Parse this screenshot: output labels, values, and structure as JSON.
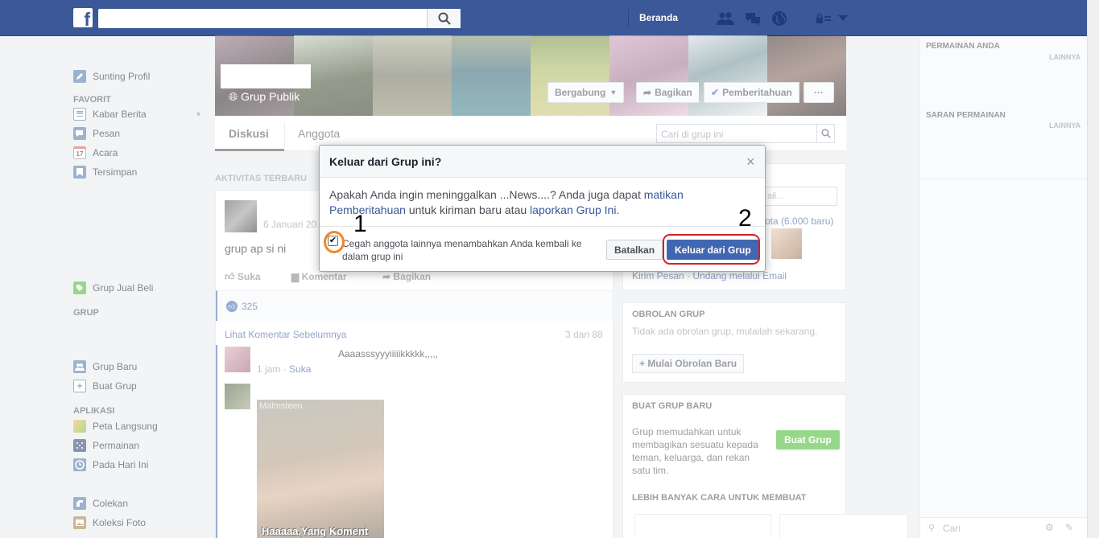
{
  "topbar": {
    "home": "Beranda"
  },
  "left_nav": {
    "profile": "Sunting Profil",
    "favorites_heading": "FAVORIT",
    "favorites": [
      "Kabar Berita",
      "Pesan",
      "Acara",
      "Tersimpan"
    ],
    "acara_date": "17",
    "group_jual_beli": "Grup Jual Beli",
    "groups_heading": "GRUP",
    "groups": [
      "Grup Baru",
      "Buat Grup"
    ],
    "apps_heading": "APLIKASI",
    "apps": [
      "Peta Langsung",
      "Permainan",
      "Pada Hari Ini"
    ],
    "more": [
      "Colekan",
      "Koleksi Foto"
    ]
  },
  "cover": {
    "group_type": "Grup Publik",
    "join_button": "Bergabung",
    "share_button": "Bagikan",
    "notif_button": "Pemberitahuan",
    "more_button": "···"
  },
  "tabs": {
    "discussion": "Diskusi",
    "members": "Anggota",
    "search_placeholder": "Cari di grup ini"
  },
  "feed": {
    "heading": "AKTIVITAS TERBARU",
    "post_date": "6 Januari 20",
    "post_text": "grup ap si ni",
    "like": "Suka",
    "comment": "Komentar",
    "share": "Bagikan",
    "like_count": "325",
    "view_prev": "Lihat Komentar Sebelumnya",
    "comment_count": "3 dari 88",
    "comment_text": "Aaaasssyyyiiiiikkkkk,,,,,",
    "comment_meta": "1 jam",
    "comment_like": "Suka",
    "meme_caption": "Haaaaa,Yang Koment",
    "meme_watermark": "Malmsteen"
  },
  "right": {
    "members_link": "ota (6.000 baru)",
    "invite_placeholder": "ail...",
    "invite_links": "Kirim Pesan · Undang melalui Email",
    "chat_title": "OBROLAN GRUP",
    "chat_text": "Tidak ada obrolan grup, mulailah sekarang.",
    "chat_button": "Mulai Obrolan Baru",
    "create_title": "BUAT GRUP BARU",
    "create_text": "Grup memudahkan untuk membagikan sesuatu kepada teman, keluarga, dan rekan satu tim.",
    "create_button": "Buat Grup",
    "more_ways": "LEBIH BANYAK CARA UNTUK MEMBUAT"
  },
  "sidebar": {
    "games_title": "PERMAINAN ANDA",
    "more1": "LAINNYA",
    "suggest_title": "SARAN PERMAINAN",
    "more2": "LAINNYA",
    "search_placeholder": "Cari"
  },
  "dialog": {
    "title": "Keluar dari Grup ini?",
    "close": "×",
    "body_pre": "Apakah Anda ingin meninggalkan ...News....? Anda juga dapat ",
    "body_link1": "matikan Pemberitahuan",
    "body_mid": " untuk kiriman baru atau ",
    "body_link2": "laporkan Grup Ini",
    "body_end": ".",
    "checkbox_label": "Cegah anggota lainnya menambahkan Anda kembali ke dalam grup ini",
    "checkbox_checked": true,
    "cancel": "Batalkan",
    "confirm": "Keluar dari Grup"
  },
  "annotations": {
    "step1": "1",
    "step2": "2"
  },
  "colors": {
    "brand": "#3b5998",
    "button_blue": "#4267b2",
    "green": "#42b72a",
    "ring_orange": "#f0872a",
    "ring_red": "#d42222"
  }
}
